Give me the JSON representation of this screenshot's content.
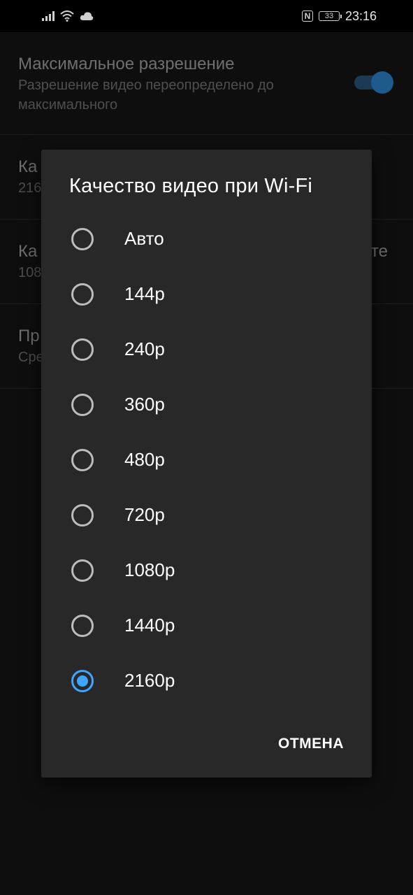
{
  "status_bar": {
    "time": "23:16",
    "battery": "33",
    "nfc": "N"
  },
  "settings": {
    "max_resolution": {
      "title": "Максимальное разрешение",
      "subtitle": "Разрешение видео переопределено до максимального",
      "enabled": true
    },
    "row2": {
      "title": "Ка",
      "subtitle": "216"
    },
    "row3": {
      "title": "Ка",
      "subtitle": "108",
      "title_right": "те"
    },
    "row4": {
      "title": "Пр",
      "subtitle": "Сре"
    }
  },
  "dialog": {
    "title": "Качество видео при Wi-Fi",
    "options": [
      "Авто",
      "144p",
      "240p",
      "360p",
      "480p",
      "720p",
      "1080p",
      "1440p",
      "2160p"
    ],
    "selected": "2160p",
    "cancel_label": "ОТМЕНА"
  },
  "colors": {
    "accent": "#3ea6ff",
    "dialog_bg": "#282828",
    "page_bg": "#0e0e0e"
  },
  "icons": [
    "signal-icon",
    "wifi-icon",
    "cloud-icon",
    "nfc-icon",
    "battery-icon"
  ]
}
